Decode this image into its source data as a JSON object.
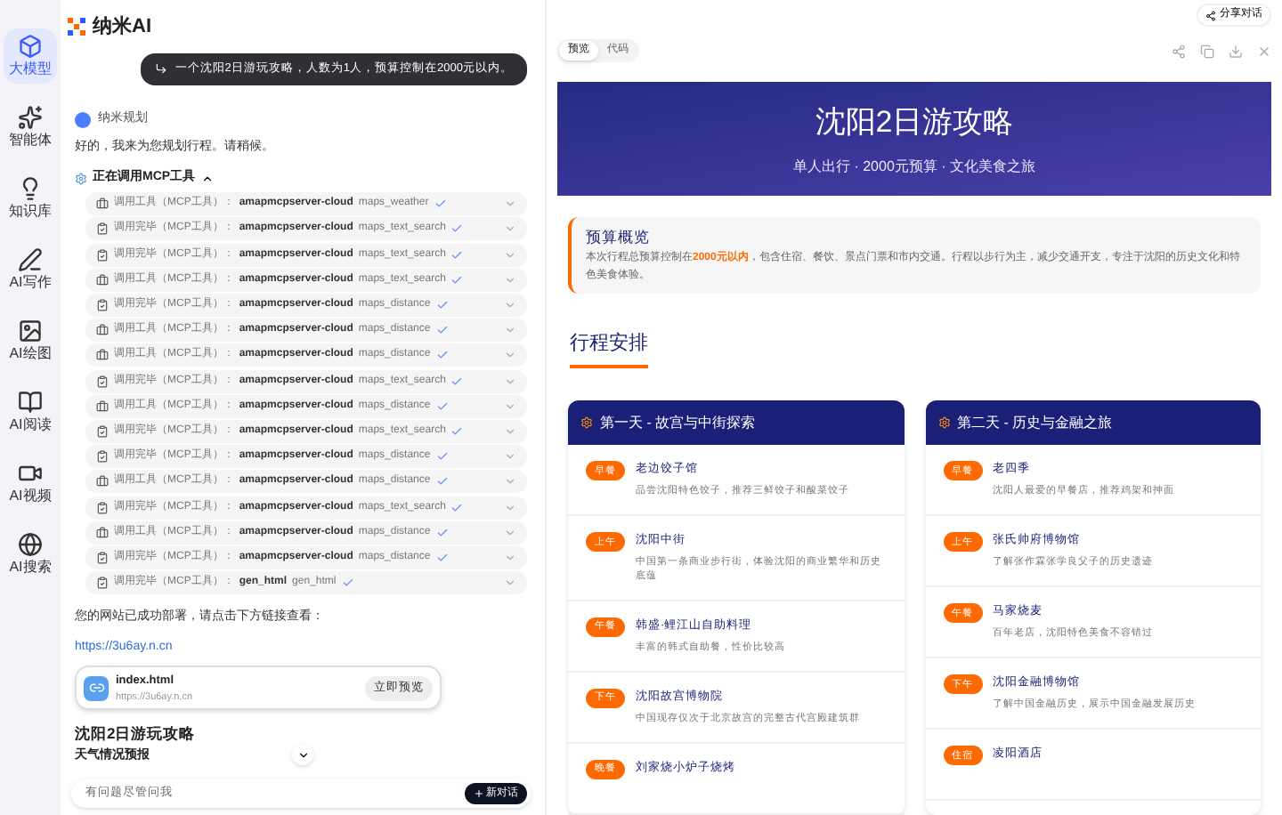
{
  "app": {
    "name": "纳米AI"
  },
  "nav": [
    {
      "label": "大模型",
      "selected": true,
      "kind": "model"
    },
    {
      "label": "智能体",
      "selected": false,
      "kind": "agent"
    },
    {
      "label": "知识库",
      "selected": false,
      "kind": "bulb"
    },
    {
      "label": "AI写作",
      "selected": false,
      "kind": "pen"
    },
    {
      "label": "AI绘图",
      "selected": false,
      "kind": "image"
    },
    {
      "label": "AI阅读",
      "selected": false,
      "kind": "read"
    },
    {
      "label": "AI视频",
      "selected": false,
      "kind": "video"
    },
    {
      "label": "AI搜索",
      "selected": false,
      "kind": "globe"
    }
  ],
  "share_button": "分享对话",
  "chat": {
    "user_message": "一个沈阳2日游玩攻略，人数为1人，预算控制在2000元以内。",
    "assistant_name": "纳米规划",
    "intro": "好的，我来为您规划行程。请稍候。",
    "tools_header": "正在调用MCP工具",
    "tools_expanded": true,
    "tool_calls": [
      {
        "kind": "call",
        "label": "调用工具（MCP工具）：",
        "server": "amapmcpserver-cloud",
        "tool": "maps_weather"
      },
      {
        "kind": "done",
        "label": "调用完毕（MCP工具）：",
        "server": "amapmcpserver-cloud",
        "tool": "maps_text_search"
      },
      {
        "kind": "done",
        "label": "调用完毕（MCP工具）：",
        "server": "amapmcpserver-cloud",
        "tool": "maps_text_search"
      },
      {
        "kind": "call",
        "label": "调用工具（MCP工具）：",
        "server": "amapmcpserver-cloud",
        "tool": "maps_text_search"
      },
      {
        "kind": "done",
        "label": "调用完毕（MCP工具）：",
        "server": "amapmcpserver-cloud",
        "tool": "maps_distance"
      },
      {
        "kind": "call",
        "label": "调用工具（MCP工具）：",
        "server": "amapmcpserver-cloud",
        "tool": "maps_distance"
      },
      {
        "kind": "call",
        "label": "调用工具（MCP工具）：",
        "server": "amapmcpserver-cloud",
        "tool": "maps_distance"
      },
      {
        "kind": "done",
        "label": "调用完毕（MCP工具）：",
        "server": "amapmcpserver-cloud",
        "tool": "maps_text_search"
      },
      {
        "kind": "call",
        "label": "调用工具（MCP工具）：",
        "server": "amapmcpserver-cloud",
        "tool": "maps_distance"
      },
      {
        "kind": "done",
        "label": "调用完毕（MCP工具）：",
        "server": "amapmcpserver-cloud",
        "tool": "maps_text_search"
      },
      {
        "kind": "done",
        "label": "调用完毕（MCP工具）：",
        "server": "amapmcpserver-cloud",
        "tool": "maps_distance"
      },
      {
        "kind": "call",
        "label": "调用工具（MCP工具）：",
        "server": "amapmcpserver-cloud",
        "tool": "maps_distance"
      },
      {
        "kind": "done",
        "label": "调用完毕（MCP工具）：",
        "server": "amapmcpserver-cloud",
        "tool": "maps_text_search"
      },
      {
        "kind": "call",
        "label": "调用工具（MCP工具）：",
        "server": "amapmcpserver-cloud",
        "tool": "maps_distance"
      },
      {
        "kind": "done",
        "label": "调用完毕（MCP工具）：",
        "server": "amapmcpserver-cloud",
        "tool": "maps_distance"
      },
      {
        "kind": "done",
        "label": "调用完毕（MCP工具）：",
        "server": "gen_html",
        "tool": "gen_html"
      }
    ],
    "deploy_text": "您的网站已成功部署，请点击下方链接查看：",
    "link": "https://3u6ay.n.cn",
    "file_card": {
      "name": "index.html",
      "url": "https://3u6ay.n.cn",
      "button": "立即预览"
    },
    "answer_title": "沈阳2日游玩攻略",
    "answer_next": "天气情况预报",
    "input": {
      "placeholder": "有问题尽管问我"
    },
    "send_button": "新对话"
  },
  "preview": {
    "tabs": [
      {
        "label": "预览",
        "selected": true
      },
      {
        "label": "代码",
        "selected": false
      }
    ],
    "banner": {
      "title": "沈阳2日游攻略",
      "subtitle": "单人出行 · 2000元预算 · 文化美食之旅"
    },
    "budget": {
      "title": "预算概览",
      "text": "本次行程总预算控制在**2000元以内**，包含住宿、餐饮、景点门票和市内交通。行程以步行为主，减少交通开支，专注于沈阳的历史文化和特色美食体验。"
    },
    "section_title": "行程安排",
    "days": [
      {
        "title": "第一天 - 故宫与中街探索",
        "items": [
          {
            "time": "早餐",
            "name": "老边饺子馆",
            "desc": "品尝沈阳特色饺子，推荐三鲜饺子和酸菜饺子"
          },
          {
            "time": "上午",
            "name": "沈阳中街",
            "desc": "中国第一条商业步行街，体验沈阳的商业繁华和历史底蕴"
          },
          {
            "time": "午餐",
            "name": "韩盛·鲤江山自助料理",
            "desc": "丰富的韩式自助餐，性价比较高"
          },
          {
            "time": "下午",
            "name": "沈阳故宫博物院",
            "desc": "中国现存仅次于北京故宫的完整古代宫殿建筑群"
          },
          {
            "time": "晚餐",
            "name": "刘家烧小炉子烧烤"
          }
        ]
      },
      {
        "title": "第二天 - 历史与金融之旅",
        "items": [
          {
            "time": "早餐",
            "name": "老四季",
            "desc": "沈阳人最爱的早餐店，推荐鸡架和抻面"
          },
          {
            "time": "上午",
            "name": "张氏帅府博物馆",
            "desc": "了解张作霖张学良父子的历史遗迹"
          },
          {
            "time": "午餐",
            "name": "马家烧麦",
            "desc": "百年老店，沈阳特色美食不容错过"
          },
          {
            "time": "下午",
            "name": "沈阳金融博物馆",
            "desc": "了解中国金融历史，展示中国金融发展历史"
          },
          {
            "time": "住宿",
            "name": "凌阳酒店"
          }
        ]
      }
    ]
  }
}
